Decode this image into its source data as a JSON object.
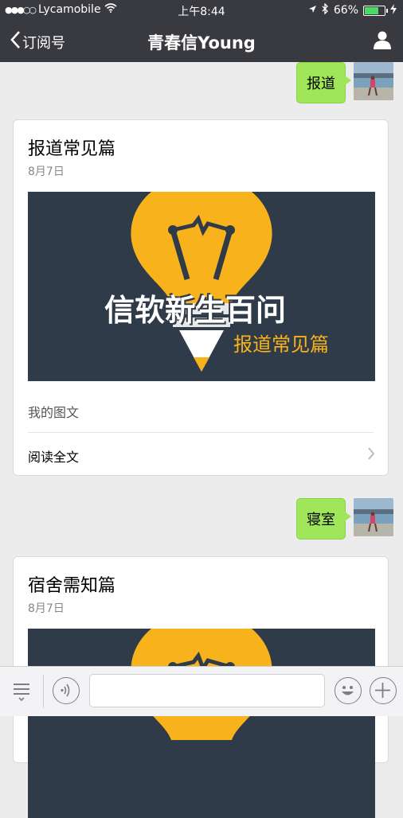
{
  "status_bar": {
    "signal": "●●●○○",
    "carrier": "Lycamobile",
    "time": "上午8:44",
    "battery": "66%",
    "battery_level": 0.66,
    "icons": [
      "wifi-icon",
      "location-arrow-icon",
      "bluetooth-icon",
      "battery-icon",
      "charging-icon"
    ]
  },
  "nav": {
    "back_label": "订阅号",
    "title": "青春信Young",
    "icons": [
      "chevron-left-icon",
      "user-icon"
    ]
  },
  "messages": [
    {
      "text": "报道"
    },
    {
      "text": "寝室"
    }
  ],
  "cards": [
    {
      "title": "报道常见篇",
      "date": "8月7日",
      "cover_title": "信软新生百问",
      "cover_subtitle": "报道常见篇",
      "summary": "我的图文",
      "read_more": "阅读全文"
    },
    {
      "title": "宿舍需知篇",
      "date": "8月7日"
    }
  ],
  "colors": {
    "header_bg": "#393a3f",
    "chat_bg": "#ececec",
    "bubble": "#9fe65a",
    "bulb": "#f8b31c",
    "cover_bg": "#2f3b48",
    "cover_subtitle": "#f8b31c",
    "battery": "#4cd964"
  },
  "toolbar": {
    "icons": [
      "menu-list-icon",
      "voice-icon",
      "emoji-icon",
      "plus-icon"
    ],
    "input_value": ""
  }
}
